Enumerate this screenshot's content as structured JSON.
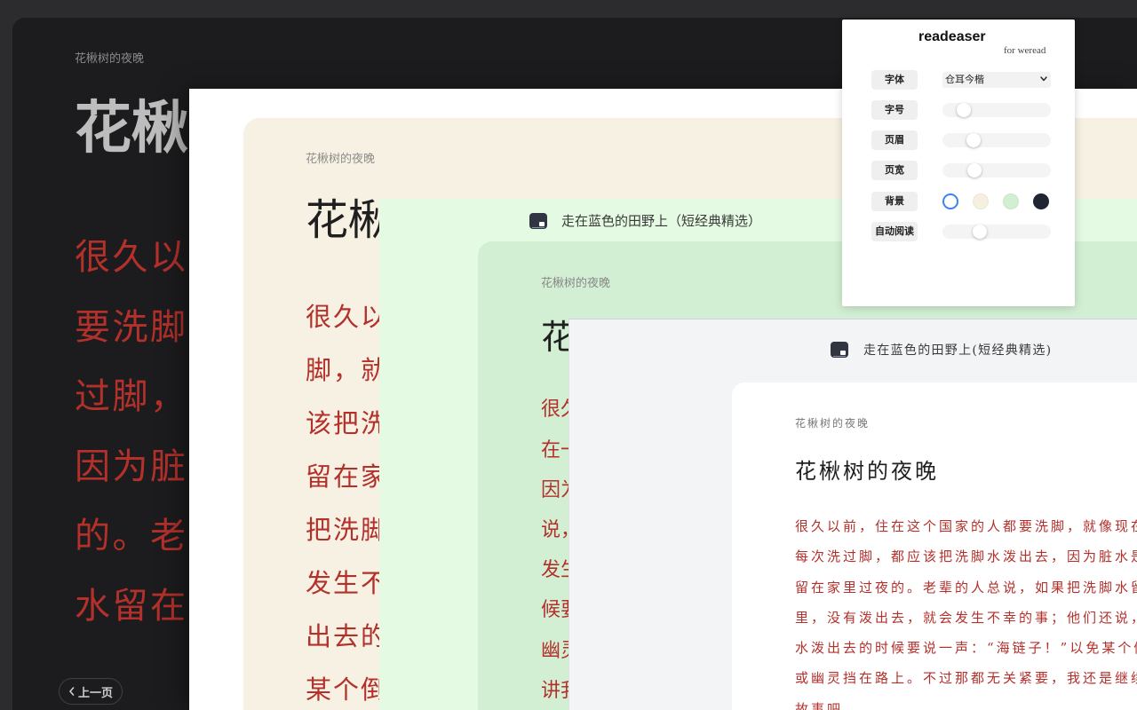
{
  "dark_reader": {
    "chapter_label": "花楸树的夜晚",
    "title": "花楸",
    "lines": [
      "很久以",
      "要洗脚",
      "过脚，",
      "因为脏",
      "的。老",
      "水留在"
    ],
    "prev_page": "上一页"
  },
  "cream_reader": {
    "chapter_label": "花楸树的夜晚",
    "title": "花楸",
    "lines": [
      "很久以",
      "脚，就",
      "该把洗",
      "留在家",
      "把洗脚",
      "发生不",
      "出去的",
      "某个倒"
    ]
  },
  "green_reader": {
    "book_title": "走在蓝色的田野上（短经典精选）",
    "chapter_label": "花楸树的夜晚",
    "title": "花",
    "lines": [
      "很久",
      "在一",
      "因为",
      "说，",
      "发生",
      "候要",
      "幽灵",
      "讲我"
    ]
  },
  "light_reader": {
    "book_title": "走在蓝色的田野上(短经典精选)",
    "chapter_label": "花楸树的夜晚",
    "title": "花楸树的夜晚",
    "lines": [
      "很久以前，住在这个国家的人都要洗脚，就像现在",
      "每次洗过脚，都应该把洗脚水泼出去，因为脏水是绝",
      "留在家里过夜的。老辈的人总说，如果把洗脚水留",
      "里，没有泼出去，就会发生不幸的事；他们还说，把",
      "水泼出去的时候要说一声：“海链子！”以免某个倒",
      "或幽灵挡在路上。不过那都无关紧要，我还是继续讲",
      "故事吧……"
    ]
  },
  "settings": {
    "brand": "readeaser",
    "tagline": "for weread",
    "font": {
      "label": "字体",
      "value": "仓耳今楷"
    },
    "font_size": {
      "label": "字号",
      "value": 0.15
    },
    "header": {
      "label": "页眉",
      "value": 0.25
    },
    "page_width": {
      "label": "页宽",
      "value": 0.26
    },
    "background": {
      "label": "背景",
      "options": [
        {
          "color": "#ffffff",
          "selected": true
        },
        {
          "color": "#f5f0df",
          "selected": false
        },
        {
          "color": "#d2efd2",
          "selected": false
        },
        {
          "color": "#1f2533",
          "selected": false
        }
      ]
    },
    "auto_read": {
      "label": "自动阅读",
      "value": 0.32
    }
  },
  "colors": {
    "page_bg": "#2c2c2e",
    "dark_bg": "#1c1c1e",
    "cream_bg": "#f6f1e2",
    "mint_bg": "#e4fae3",
    "green_bg": "#d3efd3",
    "gray_bg": "#f3f4f6",
    "text_red": "#b3302b",
    "accent_blue": "#3b82f6"
  },
  "icons": {
    "book": "book-icon",
    "prev": "chevron-left-icon",
    "select": "chevron-down-icon"
  }
}
